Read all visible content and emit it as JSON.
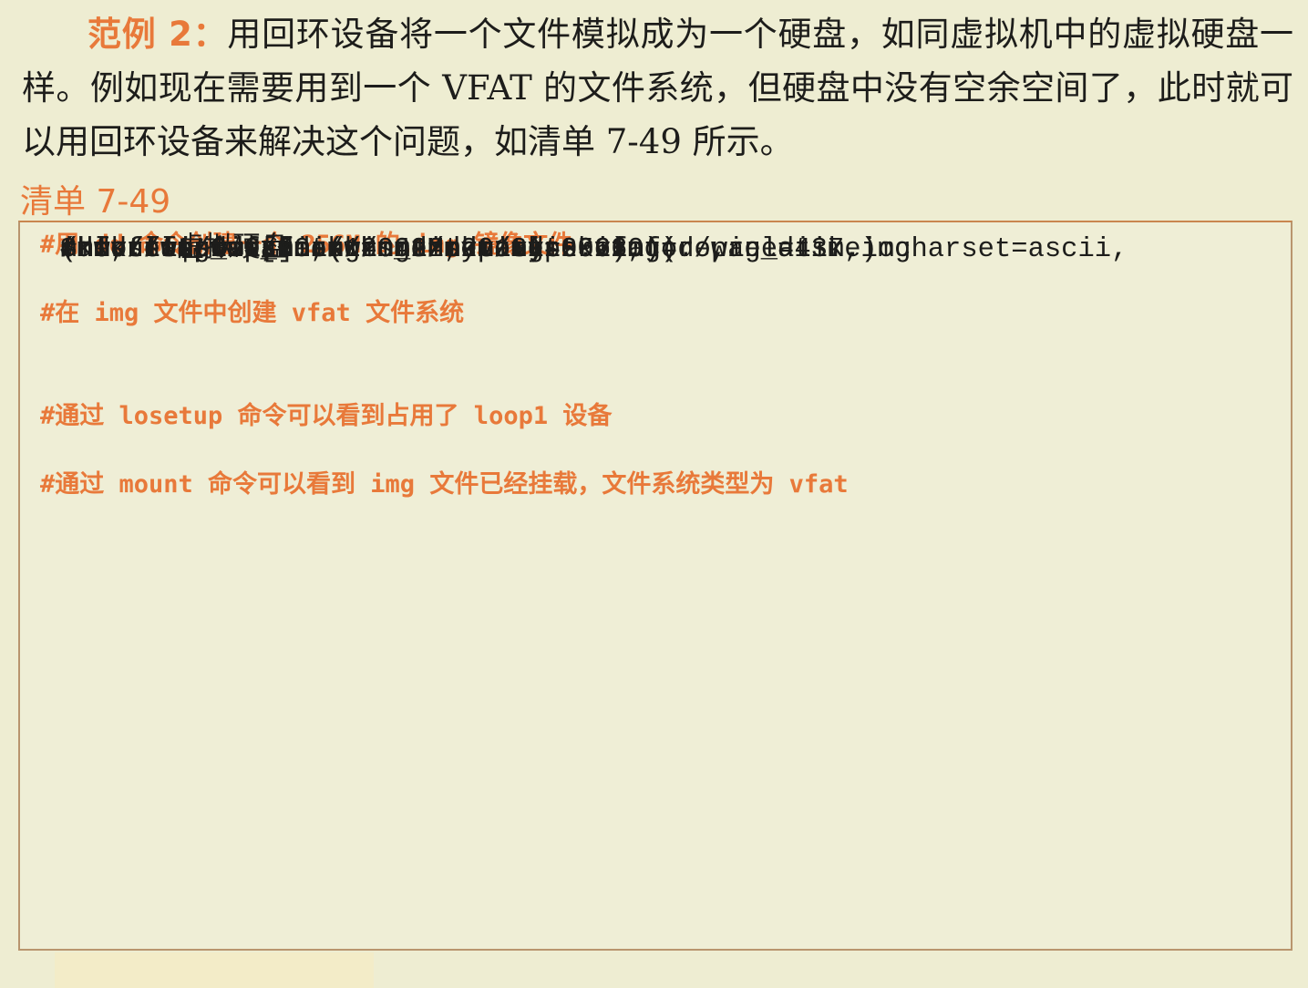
{
  "paragraph": {
    "lead": "范例 2：",
    "text": "用回环设备将一个文件模拟成为一个硬盘，如同虚拟机中的虚拟硬盘一样。例如现在需要用到一个 VFAT 的文件系统，但硬盘中没有空余空间了，此时就可以用回环设备来解决这个问题，如清单 7-49 所示。"
  },
  "listing_title": "清单 7-49",
  "code_lines": [
    {
      "type": "comment",
      "text": "#用 dd 命令创建一个 256M 的.img 镜像文件"
    },
    {
      "type": "code",
      "text": "# dd if=/dev/zero bs=1M count=256 of=./win_disk.img"
    },
    {
      "type": "blank",
      "text": ""
    },
    {
      "type": "comment",
      "text": "#在 img 文件中创建 vfat 文件系统"
    },
    {
      "type": "code",
      "text": "# mkfs -t vfat ./win_disk.img"
    },
    {
      "type": "code",
      "text": "mkfs.fat 3.0.20 (12 Jun 2013)"
    },
    {
      "type": "blank",
      "text": ""
    },
    {
      "type": "code",
      "text": "#mount 虚拟硬盘"
    },
    {
      "type": "code",
      "text": "#mount ./win_disk.img /mnt/"
    },
    {
      "type": "blank",
      "text": ""
    },
    {
      "type": "comment",
      "text": "#通过 losetup 命令可以看到占用了 loop1 设备"
    },
    {
      "type": "code",
      "text": "$ losetup -a"
    },
    {
      "type": "code",
      "text": "/dev/loop0: []: (/home/dev/test.iso)"
    },
    {
      "type": "code",
      "text": "/dev/loop1: []: (/home/dev/vdisk.img)"
    },
    {
      "type": "blank",
      "text": ""
    },
    {
      "type": "comment",
      "text": "#通过 mount 命令可以看到 img 文件已经挂载，文件系统类型为 vfat"
    },
    {
      "type": "code",
      "text": "# mount|grep mnt"
    },
    {
      "type": "code",
      "text": "/root/test.iso on /mnt type iso9660 (ro,relatime)"
    },
    {
      "type": "code",
      "text": "/root/win_disk.img on /mnt type vfat"
    },
    {
      "type": "code",
      "text": "(rw,relatime,fmask=0022,dmask=0022,codepage=437,iocharset=ascii,"
    },
    {
      "type": "code",
      "text": "shortname=mixed,errors=remount-ro)"
    }
  ],
  "colors": {
    "accent": "#e8793a",
    "page": "#eeedd2",
    "text": "#1d1d1b"
  }
}
